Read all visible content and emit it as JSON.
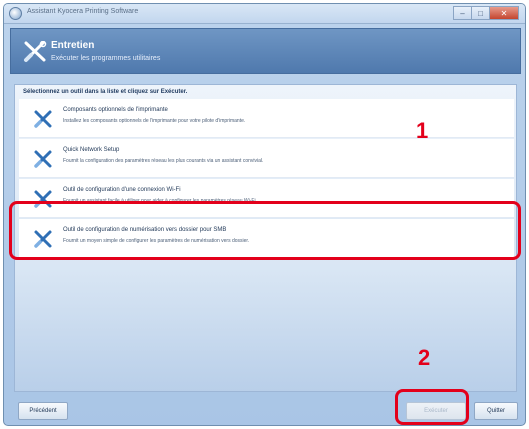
{
  "window": {
    "title": "Assistant Kyocera Printing Software"
  },
  "header": {
    "title": "Entretien",
    "subtitle": "Exécuter les programmes utilitaires"
  },
  "instruction": "Sélectionnez un outil dans la liste et cliquez sur Exécuter.",
  "tools": [
    {
      "name": "Composants optionnels de l'imprimante",
      "description": "Installez les composants optionnels de l'imprimante pour votre pilote d'imprimante."
    },
    {
      "name": "Quick Network Setup",
      "description": "Fournit la configuration des paramètres réseau les plus courants via un assistant convivial."
    },
    {
      "name": "Outil de configuration d'une connexion Wi-Fi",
      "description": "Fournit un assistant facile à utiliser pour aider à configurer les paramètres réseau Wi-Fi."
    },
    {
      "name": "Outil de configuration de numérisation vers dossier pour SMB",
      "description": "Fournit un moyen simple de configurer les paramètres de numérisation vers dossier."
    }
  ],
  "annotations": {
    "step1": "1",
    "step2": "2"
  },
  "buttons": {
    "previous": "Précédent",
    "execute": "Exécuter",
    "quit": "Quitter"
  },
  "colors": {
    "highlight": "#e3001b",
    "header": "#4f79ad",
    "tool_icon": "#2f6fb5"
  }
}
